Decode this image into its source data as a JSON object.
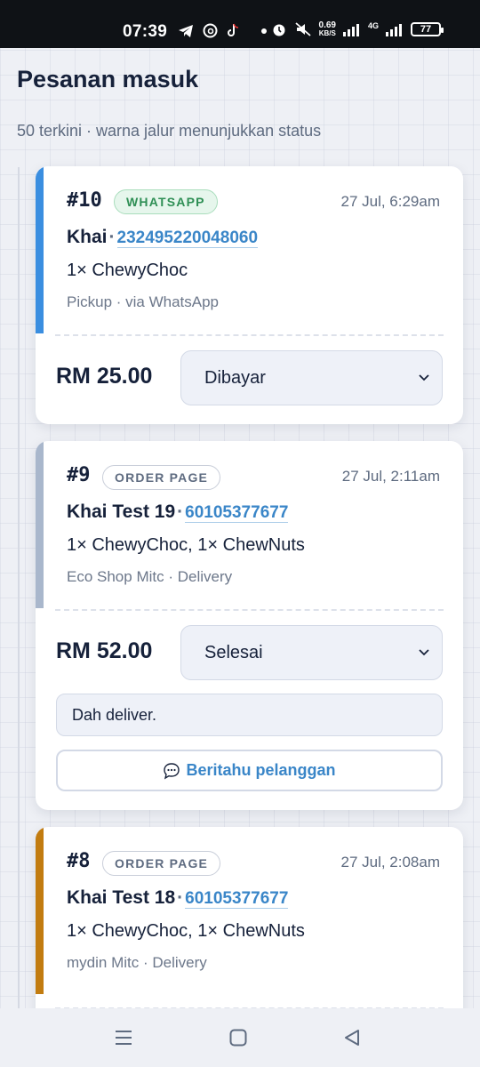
{
  "status_bar": {
    "time": "07:39",
    "net_speed_value": "0.69",
    "net_speed_unit": "KB/S",
    "net_type": "4G",
    "battery": "77"
  },
  "header": {
    "title": "Pesanan masuk",
    "subtitle": "50 terkini · warna jalur menunjukkan status"
  },
  "orders": [
    {
      "number": "#10",
      "channel": "WHATSAPP",
      "date": "27 Jul, 6:29am",
      "customer": "Khai",
      "phone": "232495220048060",
      "items": "1× ChewyChoc",
      "meta": "Pickup · via WhatsApp",
      "price": "RM 25.00",
      "status": "Dibayar",
      "stripe_color": "#3a8ee0"
    },
    {
      "number": "#9",
      "channel": "ORDER PAGE",
      "date": "27 Jul, 2:11am",
      "customer": "Khai Test 19",
      "phone": "60105377677",
      "items": "1× ChewyChoc, 1× ChewNuts",
      "meta": "Eco Shop Mitc · Delivery",
      "price": "RM 52.00",
      "status": "Selesai",
      "note": "Dah deliver.",
      "notify_label": "Beritahu pelanggan",
      "stripe_color": "#a9b7cc"
    },
    {
      "number": "#8",
      "channel": "ORDER PAGE",
      "date": "27 Jul, 2:08am",
      "customer": "Khai Test 18",
      "phone": "60105377677",
      "items": "1× ChewyChoc, 1× ChewNuts",
      "meta": "mydin Mitc · Delivery",
      "stripe_color": "#c27c10"
    }
  ],
  "colors": {
    "accent_link": "#3a86c8",
    "whatsapp_badge": "#2f8f55",
    "status_bar_bg": "#0f1216"
  }
}
